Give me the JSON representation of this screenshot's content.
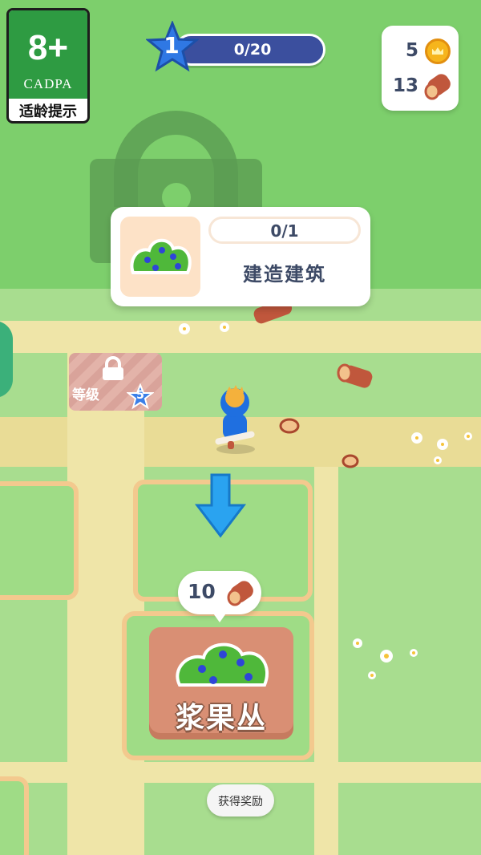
{
  "age_rating": {
    "age": "8+",
    "org": "CADPA",
    "tip": "适龄提示",
    "color": "#2e9b42"
  },
  "level": {
    "number": "1",
    "progress_text": "0/20",
    "progress_fraction": 0,
    "icon": "star-icon"
  },
  "resources": {
    "coins": "5",
    "coin_icon": "crown-coin-icon",
    "wood": "13",
    "wood_icon": "log-icon"
  },
  "objective": {
    "progress_text": "0/1",
    "label": "建造建筑",
    "icon": "berry-bush-icon"
  },
  "locked_plot": {
    "label": "等级",
    "required_level": "5",
    "icon": "lock-icon"
  },
  "build_site": {
    "cost": "10",
    "cost_icon": "log-icon",
    "name": "浆果丛",
    "icon": "berry-bush-icon",
    "pointer": "down-arrow-icon"
  },
  "reward_button": {
    "label": "获得奖励"
  }
}
